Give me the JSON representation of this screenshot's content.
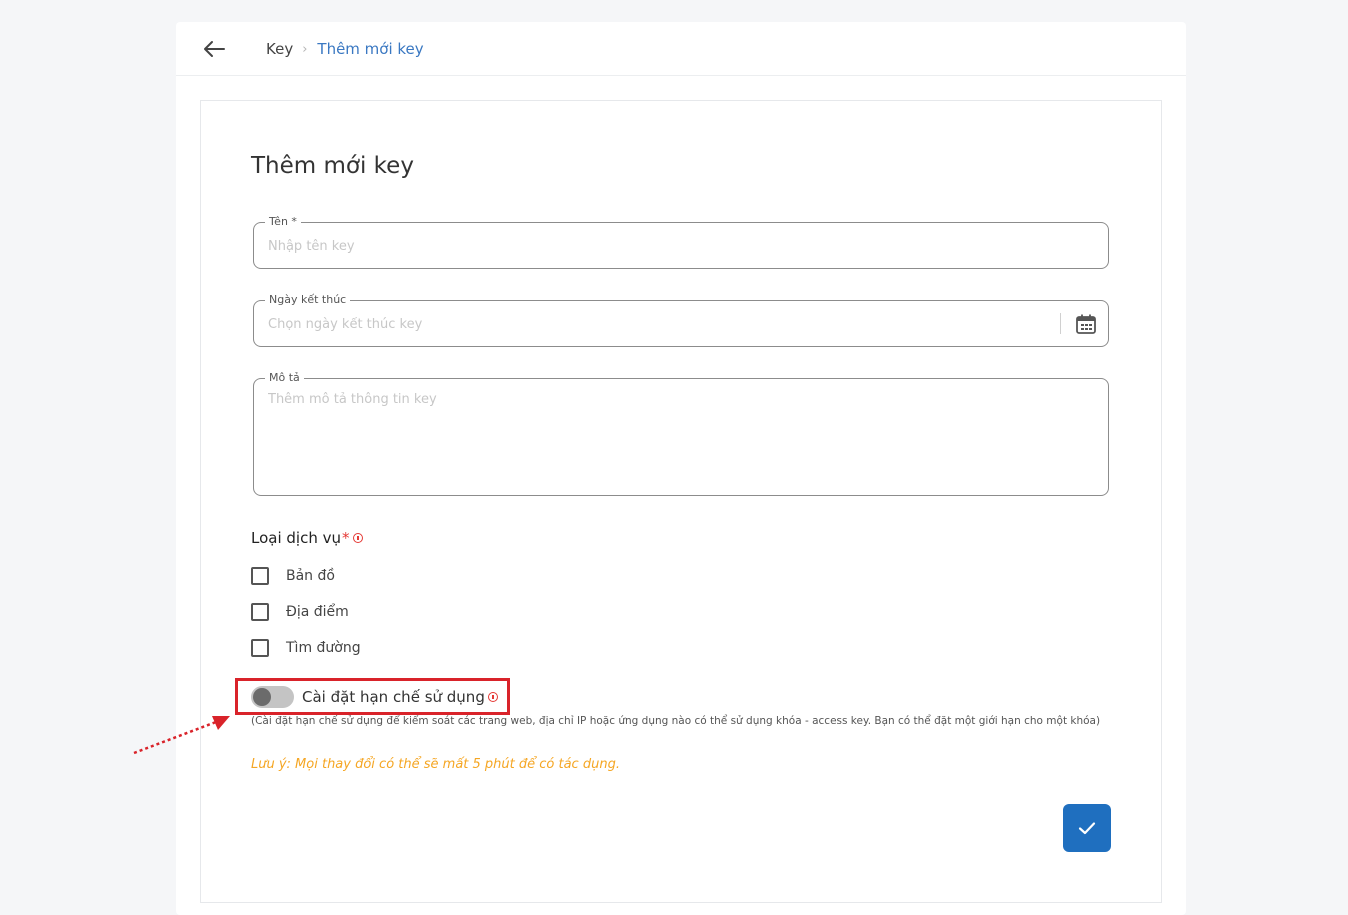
{
  "header": {
    "back_icon": "arrow-left-icon",
    "breadcrumb": {
      "root": "Key",
      "separator": "›",
      "current": "Thêm mới key"
    }
  },
  "form": {
    "title": "Thêm mới key",
    "name_field": {
      "label": "Tên",
      "required_mark": "*",
      "placeholder": "Nhập tên key",
      "value": ""
    },
    "end_date_field": {
      "label": "Ngày kết thúc",
      "placeholder": "Chọn ngày kết thúc key",
      "value": "",
      "icon": "calendar-icon"
    },
    "description_field": {
      "label": "Mô tả",
      "placeholder": "Thêm mô tả thông tin key",
      "value": ""
    },
    "service_type": {
      "heading": "Loại dịch vụ",
      "required_mark": "*",
      "options": [
        {
          "label": "Bản đồ",
          "checked": false
        },
        {
          "label": "Địa điểm",
          "checked": false
        },
        {
          "label": "Tìm đường",
          "checked": false
        }
      ]
    },
    "usage_restriction": {
      "label": "Cài đặt hạn chế sử dụng",
      "enabled": false,
      "hint": "(Cài đặt hạn chế sử dụng để kiểm soát các trang web, địa chỉ IP hoặc ứng dụng nào có thể sử dụng khóa - access key. Bạn có thể đặt một giới hạn cho một khóa)"
    },
    "note": "Lưu ý: Mọi thay đổi có thể sẽ mất 5 phút để có tác dụng.",
    "submit_icon": "check-icon"
  },
  "colors": {
    "primary": "#1f6fbf",
    "link": "#3a78c2",
    "warning_note": "#f5a623",
    "required": "#e53935",
    "annotation_red": "#d9232a"
  }
}
